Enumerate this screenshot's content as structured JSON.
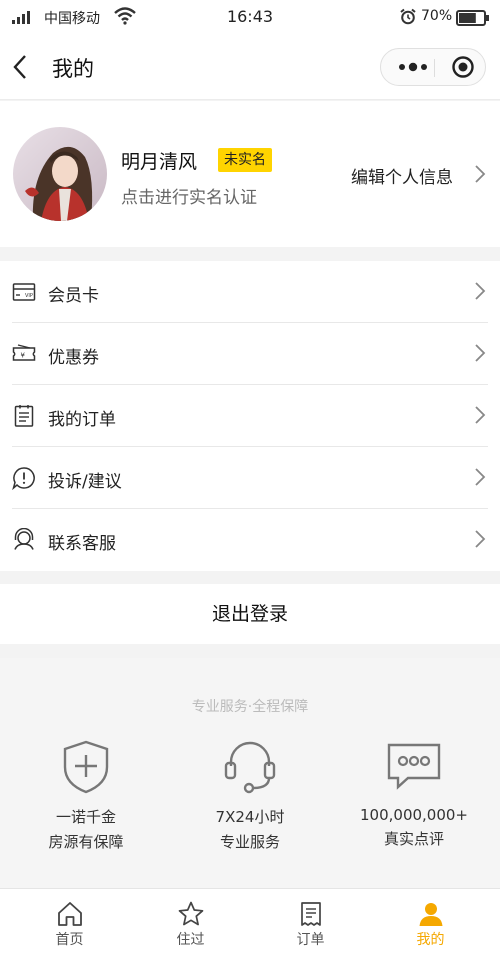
{
  "status_bar": {
    "carrier": "中国移动",
    "time": "16:43",
    "battery_percent": "70%",
    "battery_level": 0.7,
    "icons": [
      "signal-icon",
      "wifi-icon",
      "alarm-icon",
      "battery-icon"
    ]
  },
  "nav": {
    "title": "我的",
    "icons": [
      "back-icon",
      "more-icon",
      "close-miniprogram-icon"
    ]
  },
  "profile": {
    "nickname": "明月清风",
    "badge": "未实名",
    "verify_hint": "点击进行实名认证",
    "edit_label": "编辑个人信息"
  },
  "menu": {
    "items": [
      {
        "label": "会员卡",
        "icon": "vip-card-icon"
      },
      {
        "label": "优惠券",
        "icon": "coupon-icon"
      },
      {
        "label": "我的订单",
        "icon": "order-list-icon"
      },
      {
        "label": "投诉/建议",
        "icon": "complaint-icon"
      },
      {
        "label": "联系客服",
        "icon": "customer-service-icon"
      }
    ]
  },
  "logout_label": "退出登录",
  "promo": {
    "title": "专业服务·全程保障",
    "features": [
      {
        "line1": "一诺千金",
        "line2": "房源有保障",
        "icon": "shield-plus-icon"
      },
      {
        "line1": "7X24小时",
        "line2": "专业服务",
        "icon": "headset-icon"
      },
      {
        "line1": "100,000,000+",
        "line2": "真实点评",
        "icon": "chat-bubble-icon"
      }
    ]
  },
  "tabs": [
    {
      "label": "首页",
      "icon": "home-icon"
    },
    {
      "label": "住过",
      "icon": "star-icon"
    },
    {
      "label": "订单",
      "icon": "order-icon"
    },
    {
      "label": "我的",
      "icon": "profile-icon",
      "active": true
    }
  ],
  "colors": {
    "accent": "#f5a800",
    "badge_bg": "#ffd400",
    "page_bg": "#f3f3f3"
  }
}
